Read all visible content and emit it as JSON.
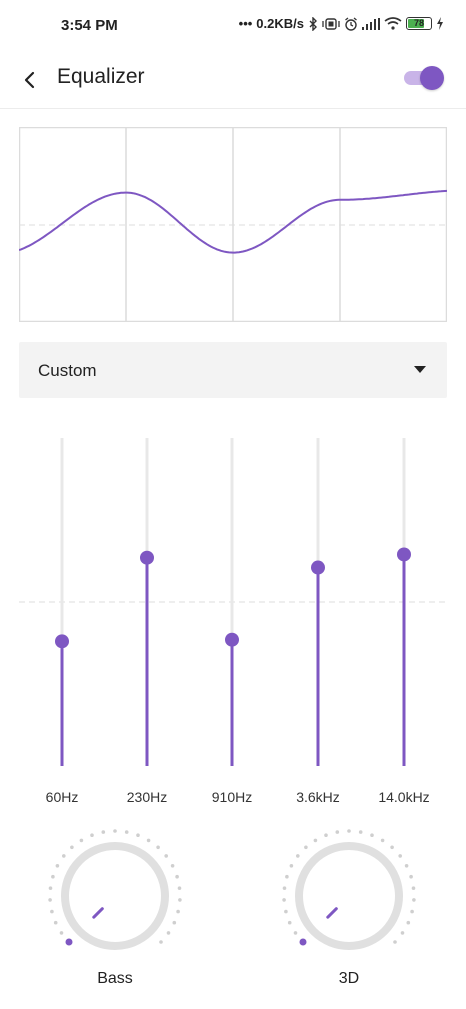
{
  "status": {
    "time": "3:54 PM",
    "net_speed": "0.2KB/s",
    "battery": "78"
  },
  "header": {
    "title": "Equalizer",
    "enabled": true
  },
  "preset": {
    "selected": "Custom"
  },
  "bands": [
    {
      "label": "60Hz",
      "level": -0.24
    },
    {
      "label": "230Hz",
      "level": 0.27
    },
    {
      "label": "910Hz",
      "level": -0.23
    },
    {
      "label": "3.6kHz",
      "level": 0.21
    },
    {
      "label": "14.0kHz",
      "level": 0.29
    }
  ],
  "knobs": [
    {
      "label": "Bass",
      "level": 0.0
    },
    {
      "label": "3D",
      "level": 0.0
    }
  ],
  "colors": {
    "accent": "#7e57c2",
    "accent_light": "#c9b4e8",
    "track": "#e8e8e8",
    "grid": "#dcdcdc"
  }
}
